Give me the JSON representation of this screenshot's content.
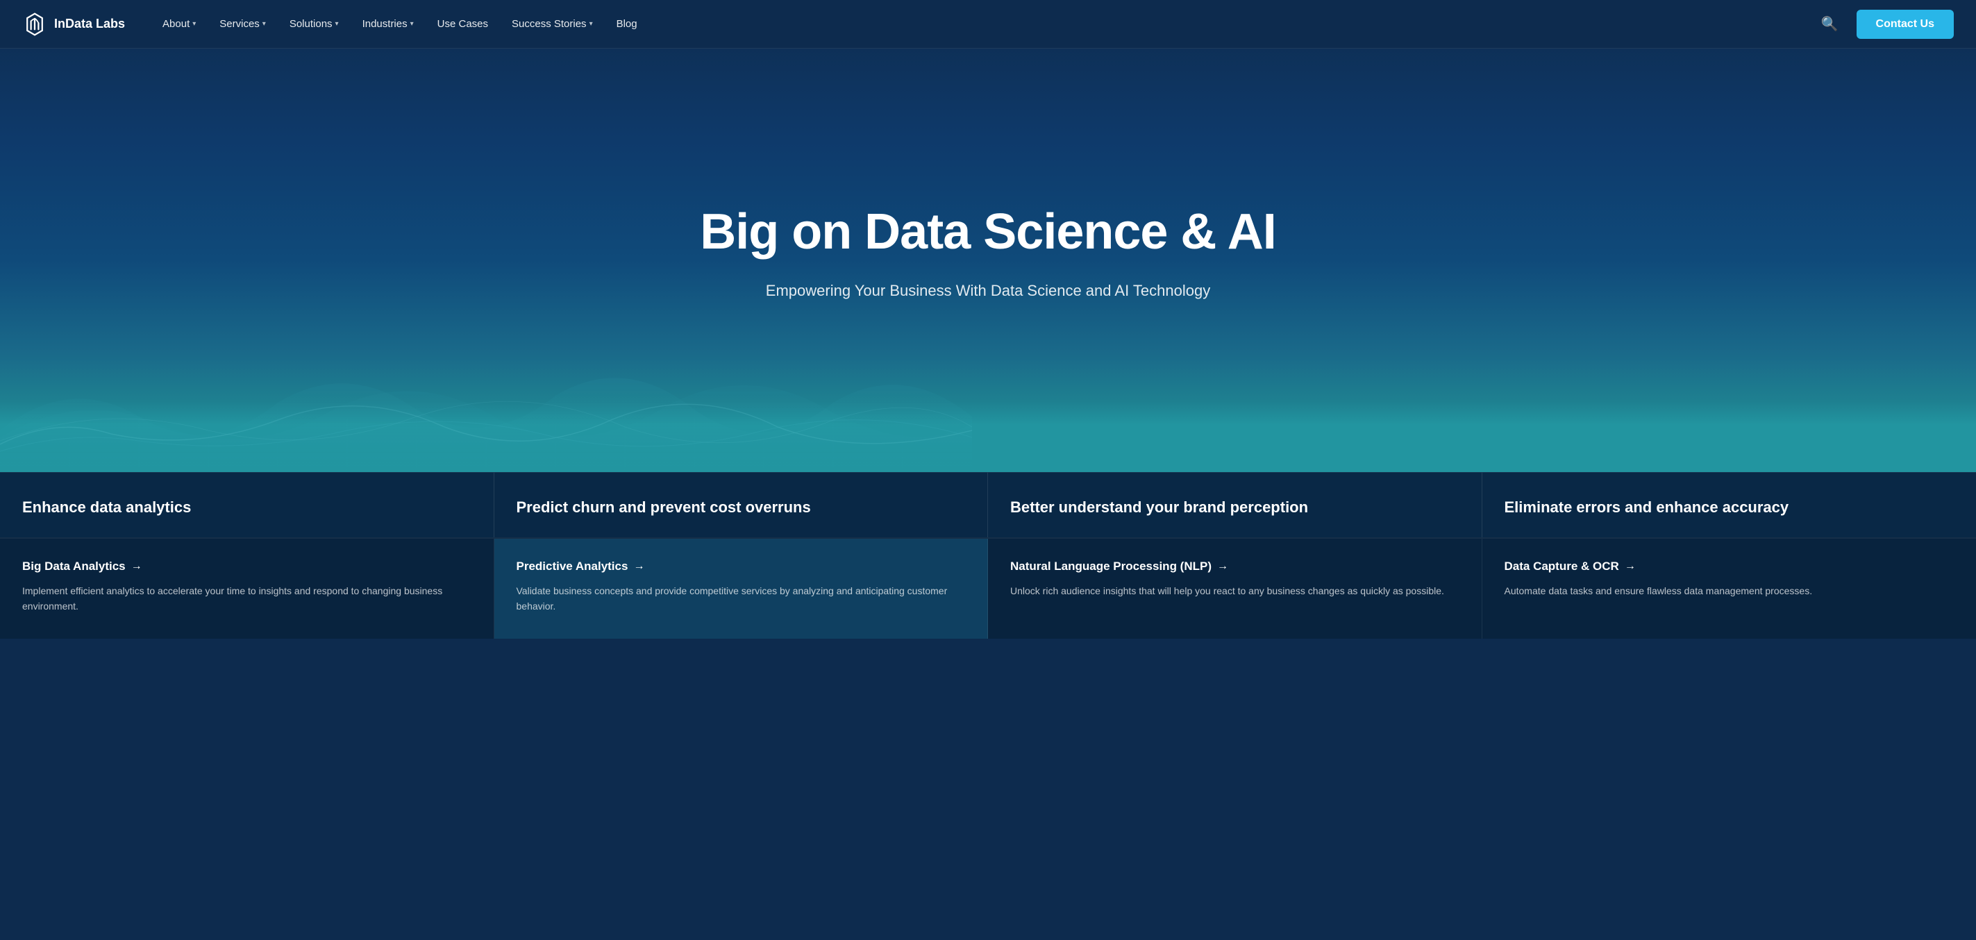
{
  "nav": {
    "logo_text": "InData Labs",
    "items": [
      {
        "label": "About",
        "has_dropdown": true
      },
      {
        "label": "Services",
        "has_dropdown": true
      },
      {
        "label": "Solutions",
        "has_dropdown": true
      },
      {
        "label": "Industries",
        "has_dropdown": true
      },
      {
        "label": "Use Cases",
        "has_dropdown": false
      },
      {
        "label": "Success Stories",
        "has_dropdown": true
      },
      {
        "label": "Blog",
        "has_dropdown": false
      }
    ],
    "contact_label": "Contact Us"
  },
  "hero": {
    "title": "Big on Data Science & AI",
    "subtitle": "Empowering Your Business With Data Science and AI Technology"
  },
  "cards": [
    {
      "title": "Enhance data analytics"
    },
    {
      "title": "Predict churn and prevent cost overruns"
    },
    {
      "title": "Better understand your brand perception"
    },
    {
      "title": "Eliminate errors and enhance accuracy"
    }
  ],
  "services": [
    {
      "link_label": "Big Data Analytics",
      "description": "Implement efficient analytics to accelerate your time to insights and respond to changing business environment."
    },
    {
      "link_label": "Predictive Analytics",
      "description": "Validate business concepts and provide competitive services by analyzing and anticipating customer behavior."
    },
    {
      "link_label": "Natural Language Processing (NLP)",
      "description": "Unlock rich audience insights that will help you react to any business changes as quickly as possible."
    },
    {
      "link_label": "Data Capture & OCR",
      "description": "Automate data tasks and ensure flawless data management processes."
    }
  ]
}
